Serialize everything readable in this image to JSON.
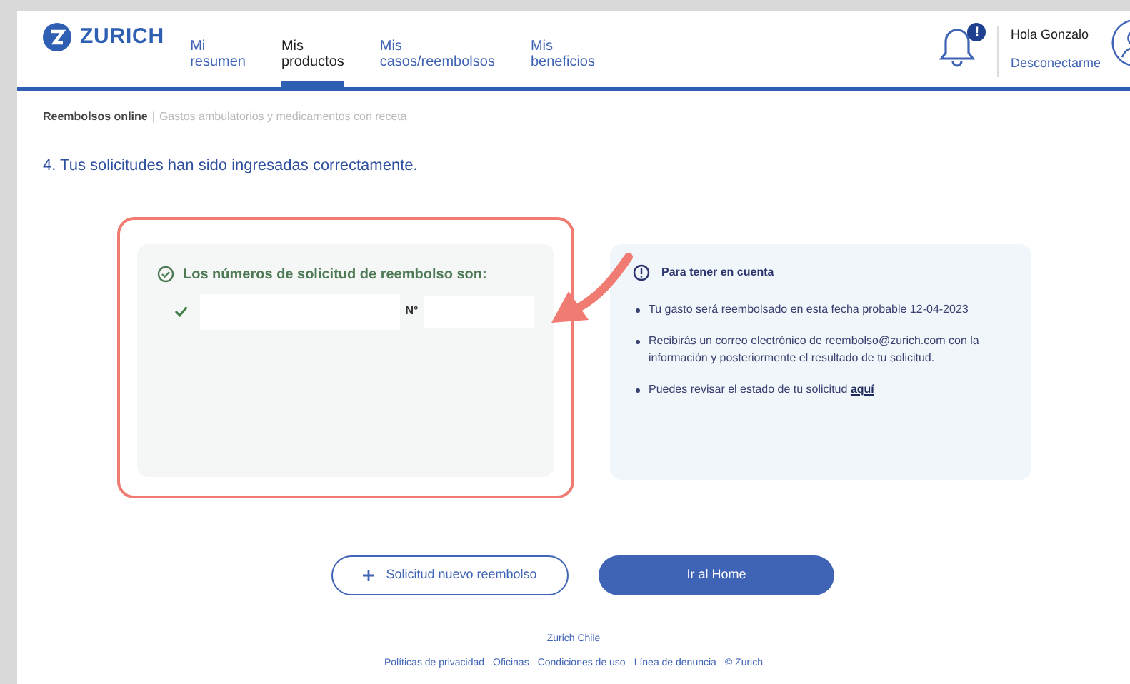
{
  "header": {
    "logo": "ZURICH",
    "nav": [
      {
        "label": "Mi resumen",
        "selected": false
      },
      {
        "label": "Mis productos",
        "selected": true
      },
      {
        "label": "Mis casos/reembolsos",
        "selected": false
      },
      {
        "label": "Mis beneficios",
        "selected": false
      }
    ],
    "notification_badge": "!",
    "greeting": "Hola Gonzalo",
    "logout": "Desconectarme"
  },
  "breadcrumb": {
    "current": "Reembolsos online",
    "separator": "|",
    "detail": "Gastos ambulatorios y medicamentos con receta"
  },
  "title": "4. Tus solicitudes han sido ingresadas correctamente.",
  "success_card": {
    "heading": "Los números de solicitud de reembolso son:",
    "number_label": "N°"
  },
  "info_card": {
    "heading": "Para tener en cuenta",
    "items": [
      {
        "text": "Tu gasto será reembolsado en esta fecha probable 12-04-2023"
      },
      {
        "text": "Recibirás un correo electrónico de reembolso@zurich.com con la información y posteriormente el resultado de tu solicitud."
      },
      {
        "text": "Puedes revisar el estado de tu solicitud",
        "link": "aquí"
      }
    ]
  },
  "buttons": {
    "secondary": "Solicitud nuevo reembolso",
    "primary": "Ir al Home"
  },
  "footer": {
    "company": "Zurich Chile",
    "links": [
      "Políticas de privacidad",
      "Oficinas",
      "Condiciones de uso",
      "Línea de denuncia",
      "© Zurich"
    ]
  }
}
